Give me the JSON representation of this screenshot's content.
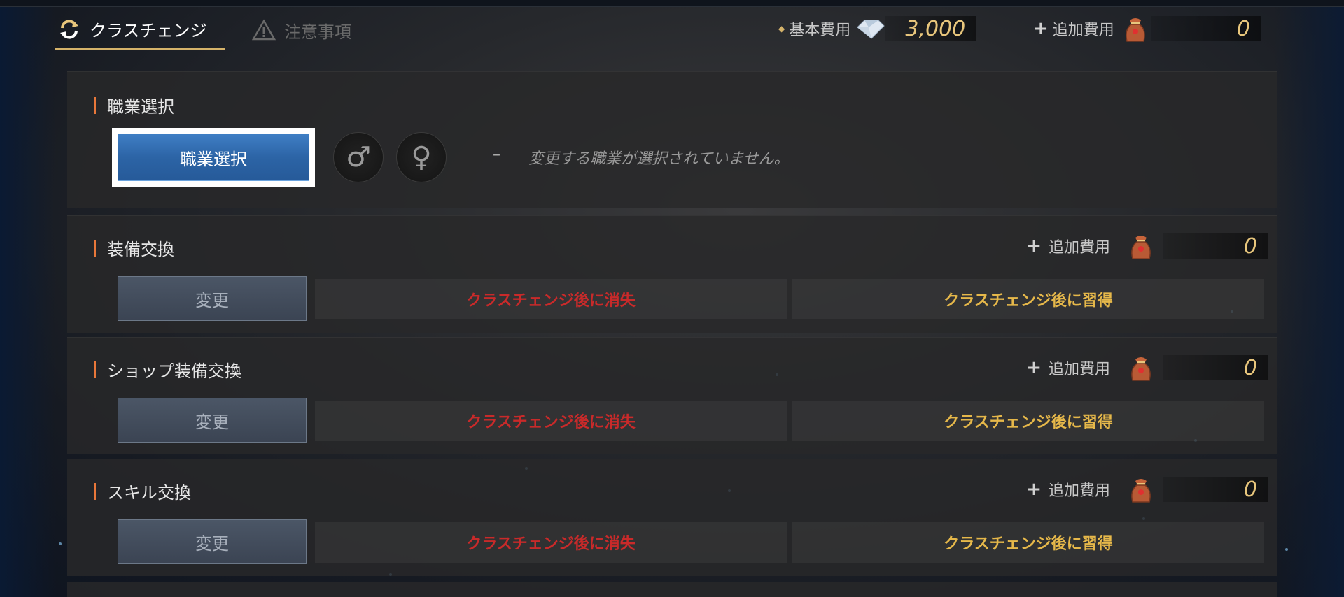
{
  "header": {
    "tabs": [
      {
        "label": "クラスチェンジ",
        "icon": "refresh-icon",
        "active": true
      },
      {
        "label": "注意事項",
        "icon": "warning-icon",
        "active": false
      }
    ],
    "base_cost": {
      "label": "基本費用",
      "value": "3,000",
      "icon": "diamond-gem-icon"
    },
    "extra_cost": {
      "label": "追加費用",
      "value": "0",
      "icon": "gold-bag-icon"
    }
  },
  "job_section": {
    "title": "職業選択",
    "button_label": "職業選択",
    "male_symbol": "♂",
    "female_symbol": "♀",
    "dash": "–",
    "message": "変更する職業が選択されていません。"
  },
  "exchange_sections": [
    {
      "title": "装備交換",
      "extra_label": "追加費用",
      "extra_value": "0",
      "change_label": "変更",
      "lost_label": "クラスチェンジ後に消失",
      "gain_label": "クラスチェンジ後に習得"
    },
    {
      "title": "ショップ装備交換",
      "extra_label": "追加費用",
      "extra_value": "0",
      "change_label": "変更",
      "lost_label": "クラスチェンジ後に消失",
      "gain_label": "クラスチェンジ後に習得"
    },
    {
      "title": "スキル交換",
      "extra_label": "追加費用",
      "extra_value": "0",
      "change_label": "変更",
      "lost_label": "クラスチェンジ後に消失",
      "gain_label": "クラスチェンジ後に習得"
    }
  ],
  "colors": {
    "accent_gold": "#d5b36a",
    "accent_orange": "#e8773a",
    "lost_red": "#c92a2a",
    "gain_gold": "#e6b84a",
    "job_button_blue": "#2c64a6"
  }
}
